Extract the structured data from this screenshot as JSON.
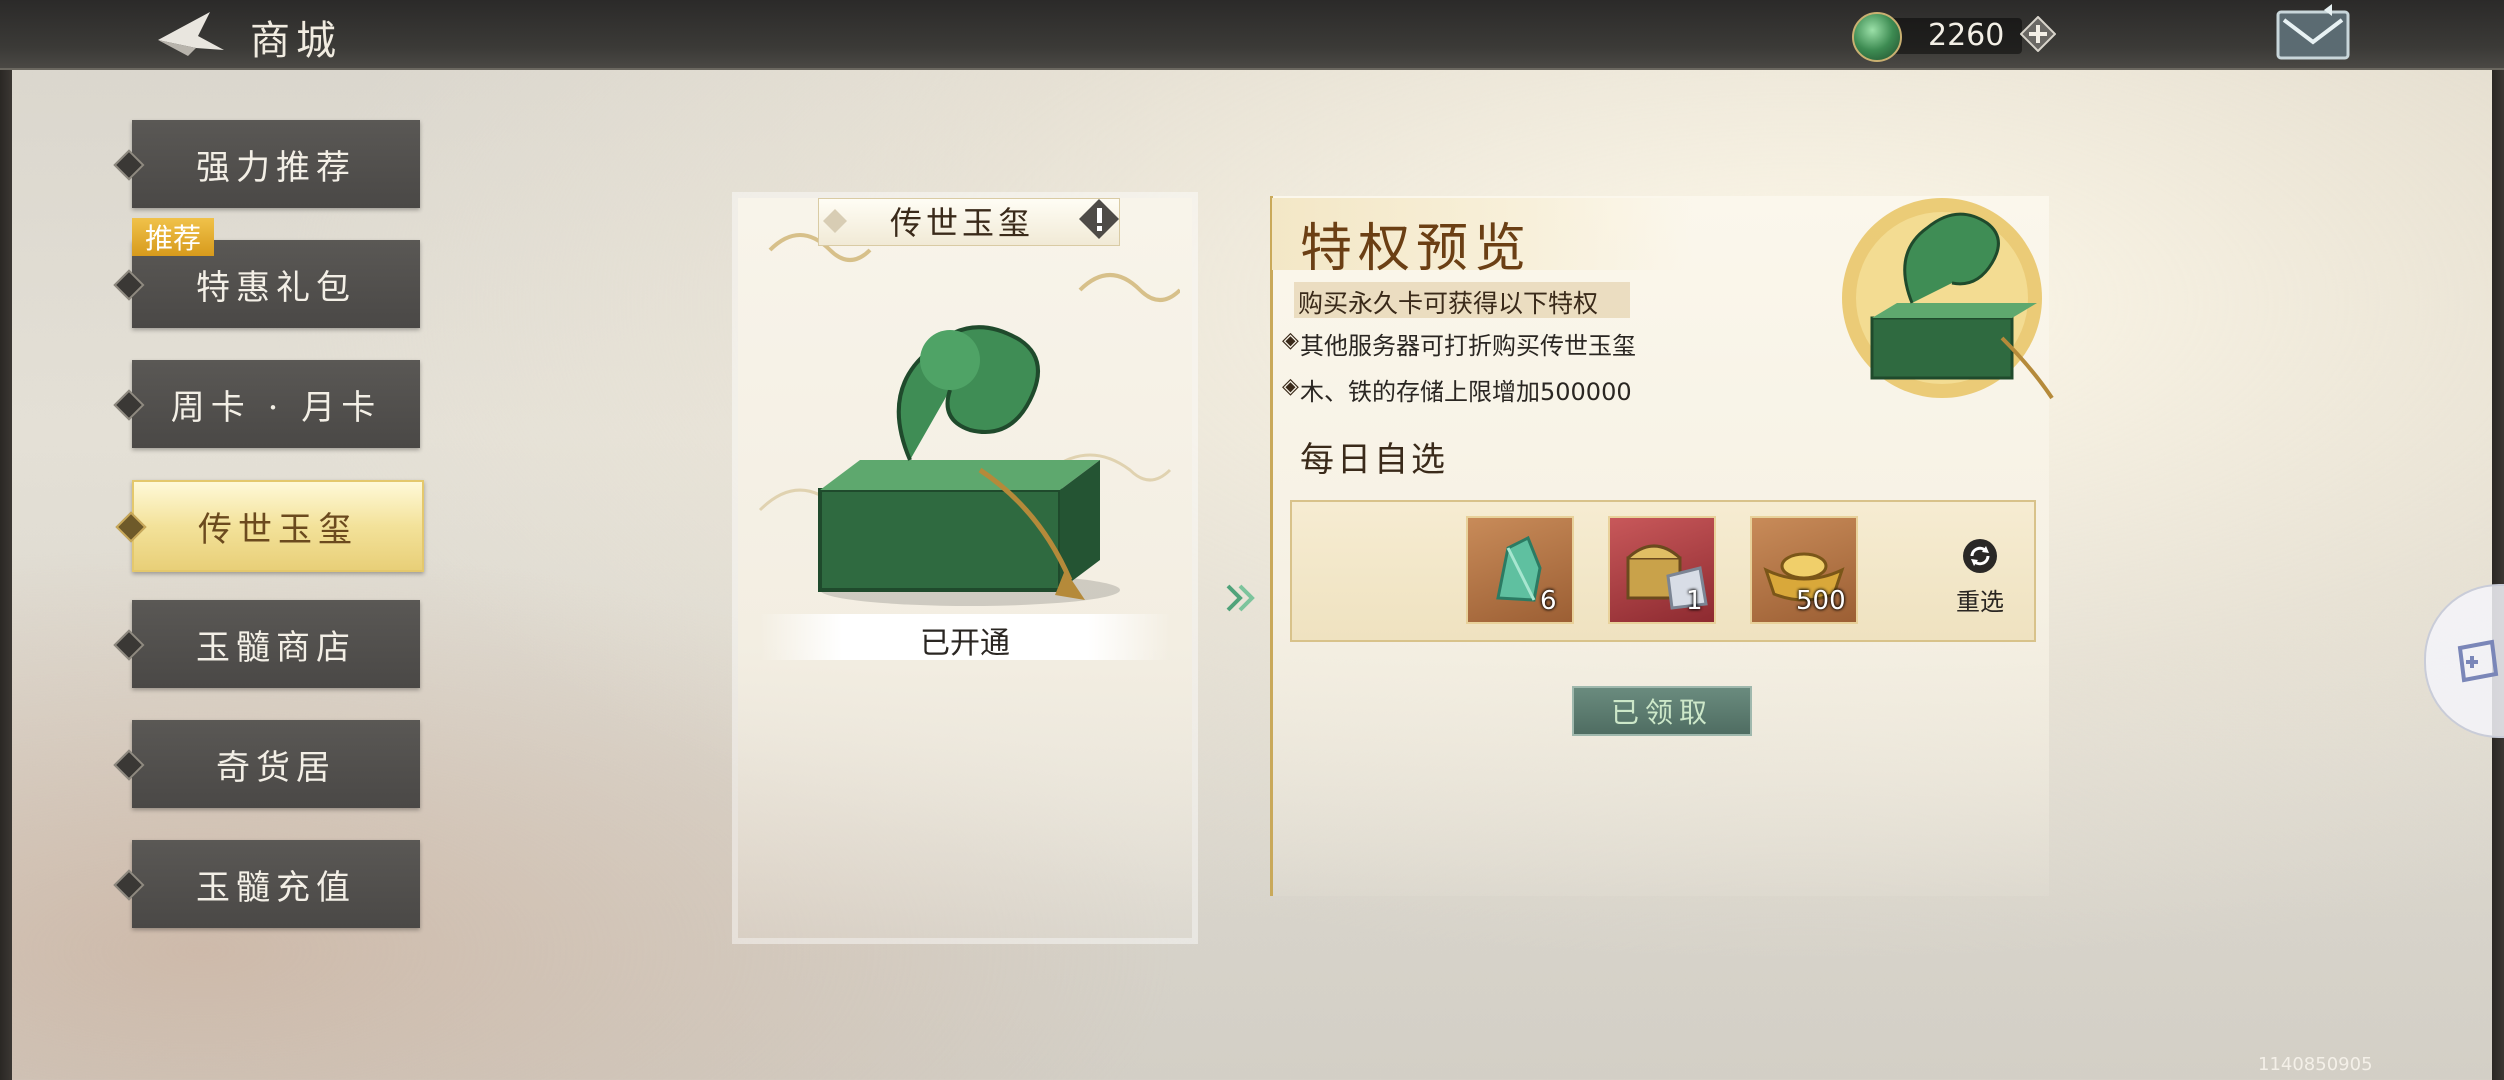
{
  "topbar": {
    "title": "商城",
    "currency_amount": "2260"
  },
  "nav": {
    "items": [
      {
        "label": "强力推荐"
      },
      {
        "label": "特惠礼包",
        "badge": "推荐"
      },
      {
        "label": "周卡 · 月卡"
      },
      {
        "label": "传世玉玺",
        "active": true
      },
      {
        "label": "玉髓商店"
      },
      {
        "label": "奇货居"
      },
      {
        "label": "玉髓充值"
      }
    ]
  },
  "card": {
    "title": "传世玉玺",
    "status": "已开通"
  },
  "privilege": {
    "title": "特权预览",
    "subtitle": "购买永久卡可获得以下特权",
    "perks": [
      "其他服务器可打折购买传世玉玺",
      "木、铁的存储上限增加500000"
    ]
  },
  "daily": {
    "title": "每日自选",
    "items": [
      {
        "icon": "jade-ore-icon",
        "count": "6"
      },
      {
        "icon": "treasure-chest-icon",
        "count": "1"
      },
      {
        "icon": "gold-ingot-icon",
        "count": "500"
      }
    ],
    "reselect_label": "重选",
    "claim_label": "已领取"
  },
  "footer": {
    "id_text": "1140850905"
  },
  "colors": {
    "accent_gold": "#e8cf78",
    "title_brown": "#6b3f14",
    "claimed_green": "#4f6d62"
  }
}
